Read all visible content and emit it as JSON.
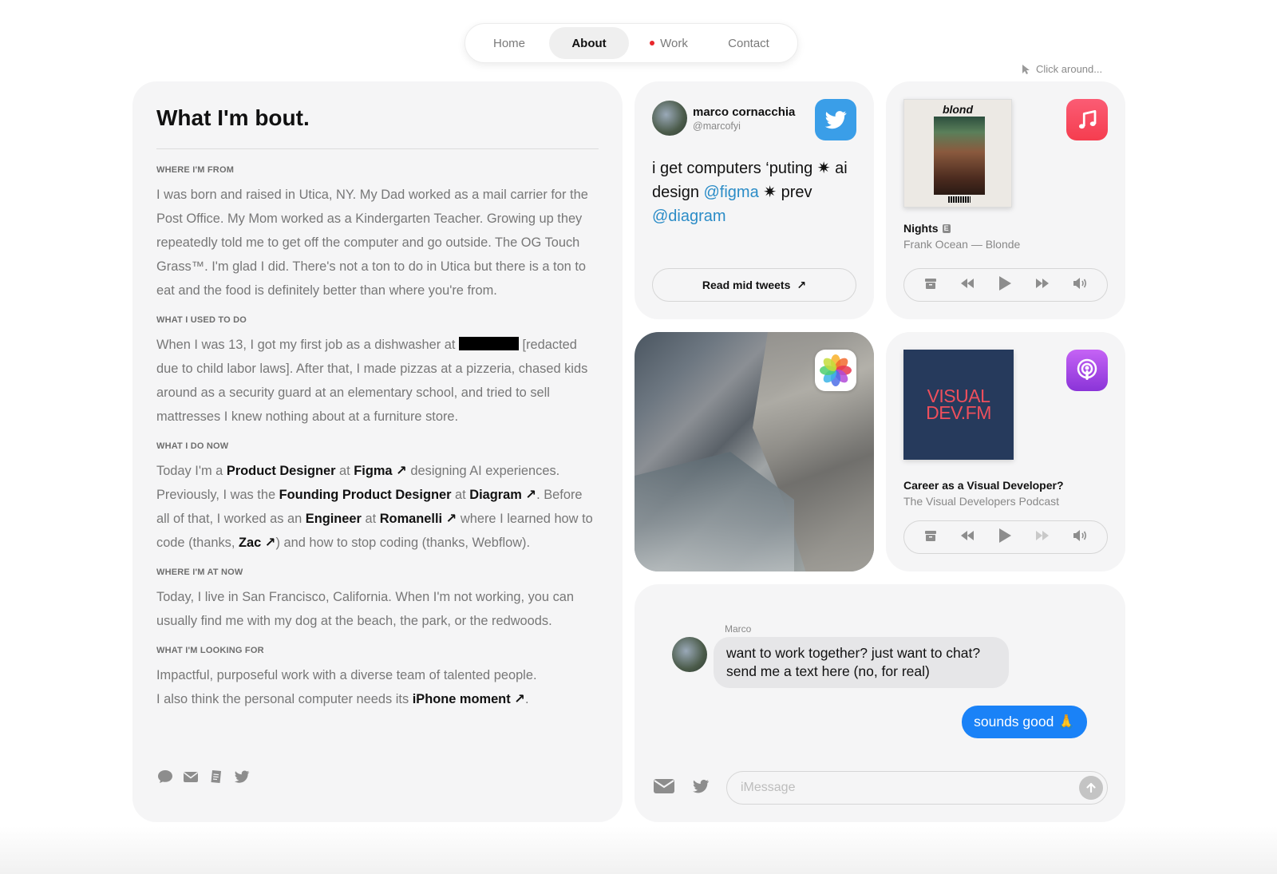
{
  "nav": {
    "items": [
      {
        "label": "Home"
      },
      {
        "label": "About"
      },
      {
        "label": "Work"
      },
      {
        "label": "Contact"
      }
    ],
    "hint": "Click around..."
  },
  "about": {
    "title": "What I'm bout.",
    "sections": [
      {
        "label": "WHERE I'M FROM",
        "text": "I was born and raised in Utica, NY. My Dad worked as a mail carrier for the Post Office. My Mom worked as a Kindergarten Teacher. Growing up they repeatedly told me to get off the computer and go outside. The OG Touch Grass™. I'm glad I did. There's not a ton to do in Utica but there is a ton to eat and the food is definitely better than where you're from."
      },
      {
        "label": "WHAT I USED TO DO",
        "text_before": "When I was 13, I got my first job as a dishwasher at",
        "text_after": "[redacted due to child labor laws]. After that, I made pizzas at a pizzeria, chased kids around as a security guard at an elementary school, and tried to sell mattresses I knew nothing about at a furniture store."
      },
      {
        "label": "WHAT I DO NOW",
        "p1": "Today I'm a",
        "role1": "Product Designer",
        "at1": "at",
        "co1": "Figma ↗",
        "p2": "designing AI experiences. Previously, I was the",
        "role2": "Founding Product Designer",
        "at2": "at",
        "co2": "Diagram ↗",
        "p3": ". Before all of that, I worked as an",
        "role3": "Engineer",
        "at3": "at",
        "co3": "Romanelli ↗",
        "p4": "where I learned how to code (thanks,",
        "zac": "Zac ↗",
        "p5": ") and how to stop coding (thanks, Webflow)."
      },
      {
        "label": "WHERE I'M AT NOW",
        "text": "Today, I live in San Francisco, California. When I'm not working, you can usually find me with my dog at the beach, the park, or the redwoods."
      },
      {
        "label": "WHAT I'M LOOKING FOR",
        "line1": "Impactful, purposeful work with a diverse team of talented people.",
        "line2": "I also think the personal computer needs its",
        "link": "iPhone moment ↗",
        "end": "."
      }
    ]
  },
  "twitter": {
    "name": "marco cornacchia",
    "handle": "@marcofyi",
    "tweet_a": "i get computers ‘puting ✷ ai design",
    "mention1": "@figma",
    "tweet_b": "✷ prev",
    "mention2": "@diagram",
    "button": "Read mid tweets",
    "button_arrow": "↗"
  },
  "music": {
    "album_text": "blond",
    "track": "Nights",
    "explicit": "E",
    "artist_album": "Frank Ocean — Blonde"
  },
  "podcast": {
    "art_line1": "VISUAL",
    "art_line2": "DEV.FM",
    "title": "Career as a Visual Developer?",
    "show": "The Visual Developers Podcast"
  },
  "messages": {
    "sender": "Marco",
    "incoming": "want to work together? just want to chat? send me a text here (no, for real)",
    "outgoing": "sounds good 🙏",
    "placeholder": "iMessage"
  },
  "colors": {
    "accent_blue": "#1a82f7",
    "twitter_blue": "#3a9ee8",
    "music_red": "#f53d4f",
    "podcast_purple": "#9b3fe0",
    "nav_dot": "#e8262b"
  }
}
